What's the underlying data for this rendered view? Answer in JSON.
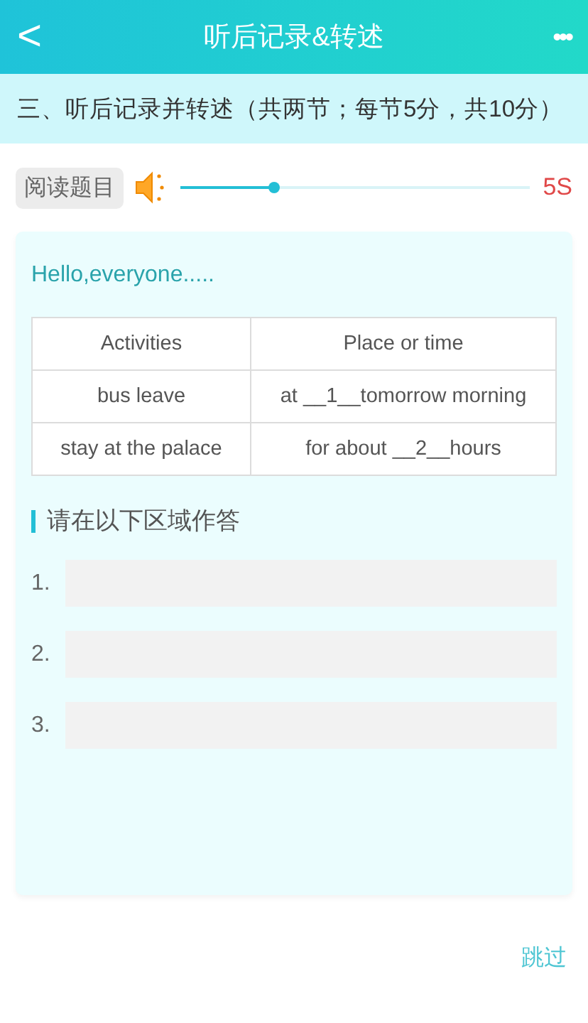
{
  "header": {
    "back": "<",
    "title": "听后记录&转述",
    "more": "•••"
  },
  "section": {
    "title": "三、听后记录并转述（共两节；每节5分，共10分）"
  },
  "audio": {
    "label": "阅读题目",
    "level": 0.27,
    "countdown": "5S"
  },
  "card": {
    "intro": "Hello,everyone.....",
    "table": {
      "columns": [
        "Activities",
        "Place or time"
      ],
      "rows": [
        [
          "bus leave",
          "at __1__tomorrow morning"
        ],
        [
          "stay at the palace",
          "for about __2__hours"
        ]
      ]
    },
    "answer_heading": "请在以下区域作答",
    "answers": [
      {
        "number": "1."
      },
      {
        "number": "2."
      },
      {
        "number": "3."
      }
    ]
  },
  "skip": "跳过"
}
